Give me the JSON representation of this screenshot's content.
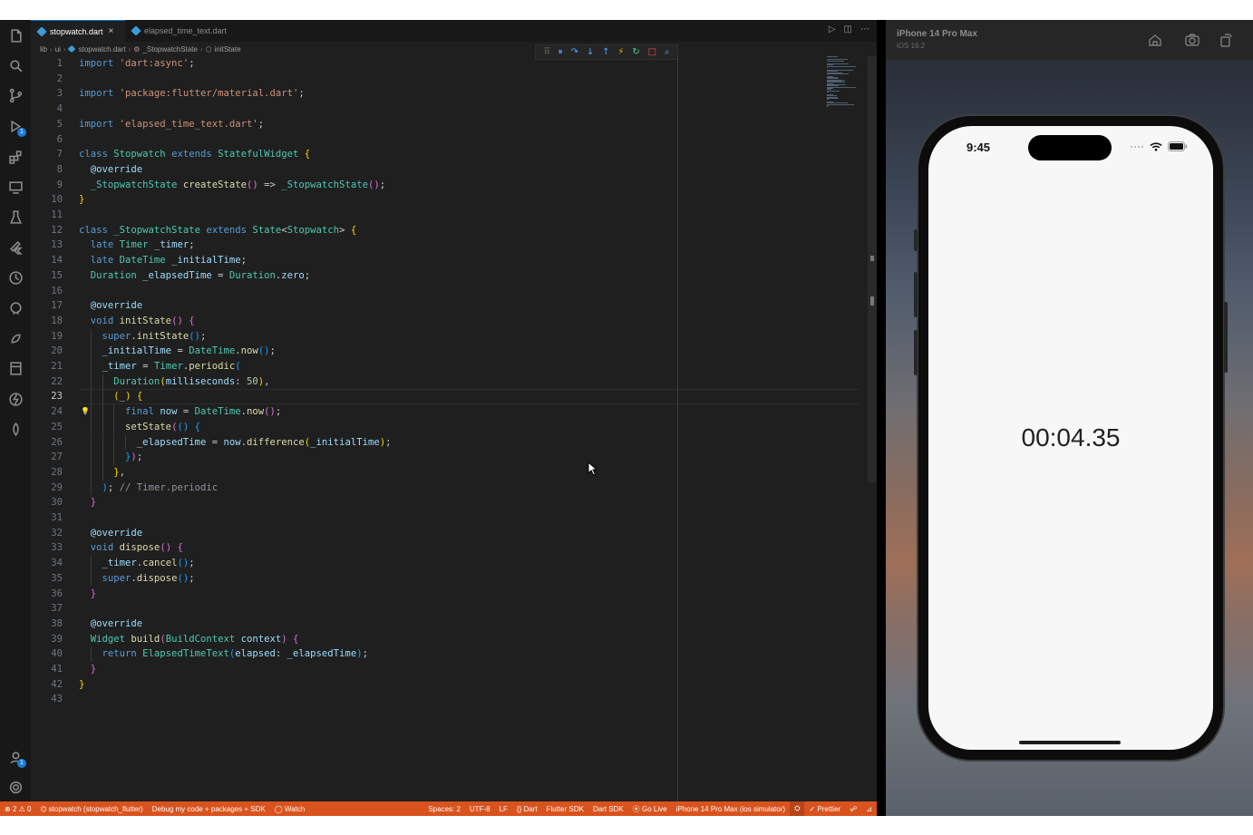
{
  "editor": {
    "tabs": [
      {
        "label": "stopwatch.dart",
        "active": true
      },
      {
        "label": "elapsed_time_text.dart",
        "active": false
      }
    ],
    "breadcrumb": [
      "lib",
      "ui",
      "stopwatch.dart",
      "_StopwatchState",
      "initState"
    ],
    "current_line": 23,
    "lines": [
      [
        [
          "kw",
          "import "
        ],
        [
          "str",
          "'dart:async'"
        ],
        [
          "p",
          ";"
        ]
      ],
      [],
      [
        [
          "kw",
          "import "
        ],
        [
          "str",
          "'package:flutter/material.dart'"
        ],
        [
          "p",
          ";"
        ]
      ],
      [],
      [
        [
          "kw",
          "import "
        ],
        [
          "str",
          "'elapsed_time_text.dart'"
        ],
        [
          "p",
          ";"
        ]
      ],
      [],
      [
        [
          "kw",
          "class "
        ],
        [
          "ty",
          "Stopwatch "
        ],
        [
          "kw",
          "extends "
        ],
        [
          "ty",
          "StatefulWidget "
        ],
        [
          "br1",
          "{"
        ]
      ],
      [
        [
          "p",
          "  "
        ],
        [
          "vr",
          "@override"
        ]
      ],
      [
        [
          "p",
          "  "
        ],
        [
          "ty",
          "_StopwatchState "
        ],
        [
          "fn",
          "createState"
        ],
        [
          "br2",
          "()"
        ],
        [
          "p",
          " => "
        ],
        [
          "ty",
          "_StopwatchState"
        ],
        [
          "br2",
          "()"
        ],
        [
          "p",
          ";"
        ]
      ],
      [
        [
          "br1",
          "}"
        ]
      ],
      [],
      [
        [
          "kw",
          "class "
        ],
        [
          "ty",
          "_StopwatchState "
        ],
        [
          "kw",
          "extends "
        ],
        [
          "ty",
          "State"
        ],
        [
          "p",
          "<"
        ],
        [
          "ty",
          "Stopwatch"
        ],
        [
          "p",
          "> "
        ],
        [
          "br1",
          "{"
        ]
      ],
      [
        [
          "p",
          "  "
        ],
        [
          "kw",
          "late "
        ],
        [
          "ty",
          "Timer "
        ],
        [
          "vr",
          "_timer"
        ],
        [
          "p",
          ";"
        ]
      ],
      [
        [
          "p",
          "  "
        ],
        [
          "kw",
          "late "
        ],
        [
          "ty",
          "DateTime "
        ],
        [
          "vr",
          "_initialTime"
        ],
        [
          "p",
          ";"
        ]
      ],
      [
        [
          "p",
          "  "
        ],
        [
          "ty",
          "Duration "
        ],
        [
          "vr",
          "_elapsedTime"
        ],
        [
          "p",
          " = "
        ],
        [
          "ty",
          "Duration"
        ],
        [
          "p",
          "."
        ],
        [
          "vr",
          "zero"
        ],
        [
          "p",
          ";"
        ]
      ],
      [],
      [
        [
          "p",
          "  "
        ],
        [
          "vr",
          "@override"
        ]
      ],
      [
        [
          "p",
          "  "
        ],
        [
          "kw",
          "void "
        ],
        [
          "fn",
          "initState"
        ],
        [
          "br2",
          "() {"
        ]
      ],
      [
        [
          "p",
          "    "
        ],
        [
          "kw",
          "super"
        ],
        [
          "p",
          "."
        ],
        [
          "fn",
          "initState"
        ],
        [
          "br3",
          "()"
        ],
        [
          "p",
          ";"
        ]
      ],
      [
        [
          "p",
          "    "
        ],
        [
          "vr",
          "_initialTime"
        ],
        [
          "p",
          " = "
        ],
        [
          "ty",
          "DateTime"
        ],
        [
          "p",
          "."
        ],
        [
          "fn",
          "now"
        ],
        [
          "br3",
          "()"
        ],
        [
          "p",
          ";"
        ]
      ],
      [
        [
          "p",
          "    "
        ],
        [
          "vr",
          "_timer"
        ],
        [
          "p",
          " = "
        ],
        [
          "ty",
          "Timer"
        ],
        [
          "p",
          "."
        ],
        [
          "fn",
          "periodic"
        ],
        [
          "br3",
          "("
        ]
      ],
      [
        [
          "p",
          "      "
        ],
        [
          "ty",
          "Duration"
        ],
        [
          "br1",
          "("
        ],
        [
          "vr",
          "milliseconds"
        ],
        [
          "p",
          ": "
        ],
        [
          "num",
          "50"
        ],
        [
          "br1",
          ")"
        ],
        [
          "p",
          ","
        ]
      ],
      [
        [
          "p",
          "      "
        ],
        [
          "br1",
          "("
        ],
        [
          "vr",
          "_"
        ],
        [
          "br1",
          ") {"
        ]
      ],
      [
        [
          "p",
          "        "
        ],
        [
          "kw",
          "final "
        ],
        [
          "vr",
          "now"
        ],
        [
          "p",
          " = "
        ],
        [
          "ty",
          "DateTime"
        ],
        [
          "p",
          "."
        ],
        [
          "fn",
          "now"
        ],
        [
          "br2",
          "()"
        ],
        [
          "p",
          ";"
        ]
      ],
      [
        [
          "p",
          "        "
        ],
        [
          "fn",
          "setState"
        ],
        [
          "br2",
          "("
        ],
        [
          "br3",
          "() {"
        ]
      ],
      [
        [
          "p",
          "          "
        ],
        [
          "vr",
          "_elapsedTime"
        ],
        [
          "p",
          " = "
        ],
        [
          "vr",
          "now"
        ],
        [
          "p",
          "."
        ],
        [
          "fn",
          "difference"
        ],
        [
          "br1",
          "("
        ],
        [
          "vr",
          "_initialTime"
        ],
        [
          "br1",
          ")"
        ],
        [
          "p",
          ";"
        ]
      ],
      [
        [
          "p",
          "        "
        ],
        [
          "br3",
          "}"
        ],
        [
          "br2",
          ")"
        ],
        [
          "p",
          ";"
        ]
      ],
      [
        [
          "p",
          "      "
        ],
        [
          "br1",
          "}"
        ],
        [
          "p",
          ","
        ]
      ],
      [
        [
          "p",
          "    "
        ],
        [
          "br3",
          ")"
        ],
        [
          "p",
          "; "
        ],
        [
          "cm-gray",
          "// Timer.periodic"
        ]
      ],
      [
        [
          "p",
          "  "
        ],
        [
          "br2",
          "}"
        ]
      ],
      [],
      [
        [
          "p",
          "  "
        ],
        [
          "vr",
          "@override"
        ]
      ],
      [
        [
          "p",
          "  "
        ],
        [
          "kw",
          "void "
        ],
        [
          "fn",
          "dispose"
        ],
        [
          "br2",
          "() {"
        ]
      ],
      [
        [
          "p",
          "    "
        ],
        [
          "vr",
          "_timer"
        ],
        [
          "p",
          "."
        ],
        [
          "fn",
          "cancel"
        ],
        [
          "br3",
          "()"
        ],
        [
          "p",
          ";"
        ]
      ],
      [
        [
          "p",
          "    "
        ],
        [
          "kw",
          "super"
        ],
        [
          "p",
          "."
        ],
        [
          "fn",
          "dispose"
        ],
        [
          "br3",
          "()"
        ],
        [
          "p",
          ";"
        ]
      ],
      [
        [
          "p",
          "  "
        ],
        [
          "br2",
          "}"
        ]
      ],
      [],
      [
        [
          "p",
          "  "
        ],
        [
          "vr",
          "@override"
        ]
      ],
      [
        [
          "p",
          "  "
        ],
        [
          "ty",
          "Widget "
        ],
        [
          "fn",
          "build"
        ],
        [
          "br2",
          "("
        ],
        [
          "ty",
          "BuildContext "
        ],
        [
          "vr",
          "context"
        ],
        [
          "br2",
          ") {"
        ]
      ],
      [
        [
          "p",
          "    "
        ],
        [
          "kw",
          "return "
        ],
        [
          "ty",
          "ElapsedTimeText"
        ],
        [
          "br3",
          "("
        ],
        [
          "vr",
          "elapsed"
        ],
        [
          "p",
          ": "
        ],
        [
          "vr",
          "_elapsedTime"
        ],
        [
          "br3",
          ")"
        ],
        [
          "p",
          ";"
        ]
      ],
      [
        [
          "p",
          "  "
        ],
        [
          "br2",
          "}"
        ]
      ],
      [
        [
          "br1",
          "}"
        ]
      ],
      []
    ]
  },
  "statusbar": {
    "problems": "⊗ 2 ⚠ 0",
    "left_items": [
      "stopwatch (stopwatch_flutter)",
      "Debug my code + packages + SDK",
      "◯ Watch"
    ],
    "right_items": [
      "Spaces: 2",
      "UTF-8",
      "LF",
      "{} Dart",
      "Flutter SDK",
      "Dart SDK",
      "Go Live",
      "iPhone 14 Pro Max (ios simulator)",
      "✓ Prettier"
    ],
    "background": "#d9531e"
  },
  "simulator": {
    "device_name": "iPhone 14 Pro Max",
    "os_version": "iOS 16.2",
    "buttons": [
      "home-icon",
      "screenshot-icon",
      "rotate-icon"
    ],
    "phone": {
      "time": "9:45",
      "elapsed": "00:04.35"
    }
  },
  "colors": {
    "editor_bg": "#1f1f1f",
    "keyword": "#569cd6",
    "string": "#ce9178",
    "type": "#4ec9b0",
    "function": "#dcdcaa",
    "variable": "#9cdcfe",
    "number": "#b5cea8",
    "status_bar": "#d9531e"
  }
}
